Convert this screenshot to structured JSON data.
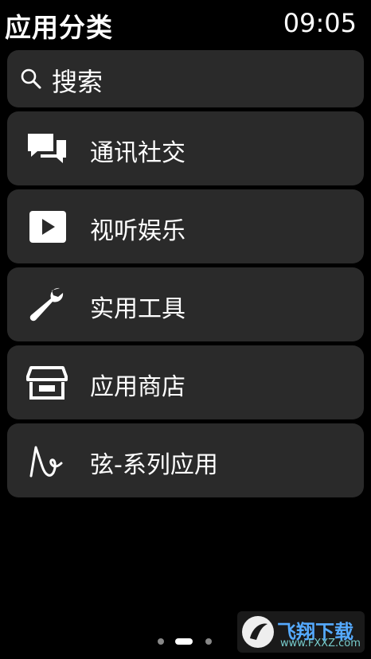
{
  "header": {
    "title": "应用分类",
    "time": "09:05"
  },
  "search": {
    "label": "搜索",
    "icon": "search-icon"
  },
  "categories": [
    {
      "label": "通讯社交",
      "icon": "chat-icon"
    },
    {
      "label": "视听娱乐",
      "icon": "play-icon"
    },
    {
      "label": "实用工具",
      "icon": "wrench-icon"
    },
    {
      "label": "应用商店",
      "icon": "store-icon"
    },
    {
      "label": "弦-系列应用",
      "icon": "xian-logo-icon"
    }
  ],
  "pager": {
    "pages": 3,
    "current": 2
  },
  "watermark": {
    "text": "飞翔下载",
    "url": "www.FXXZ.com"
  }
}
